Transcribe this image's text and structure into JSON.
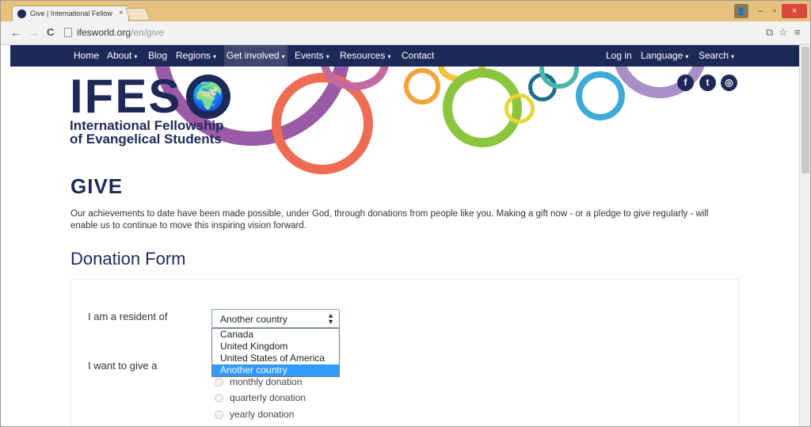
{
  "browser": {
    "tab_title": "Give | International Fellow",
    "tab_close": "×",
    "url_host": "ifesworld.org",
    "url_path": "/en/give",
    "back_icon": "←",
    "forward_icon": "→",
    "reload_icon": "C",
    "window_min": "–",
    "window_max": "▫",
    "window_close": "×"
  },
  "site_nav": {
    "left": [
      {
        "label": "Home",
        "caret": ""
      },
      {
        "label": "About",
        "caret": "▾"
      },
      {
        "label": "Blog",
        "caret": ""
      },
      {
        "label": "Regions",
        "caret": "▾"
      },
      {
        "label": "Get involved",
        "caret": "▾"
      },
      {
        "label": "Events",
        "caret": "▾"
      },
      {
        "label": "Resources",
        "caret": "▾"
      },
      {
        "label": "Contact",
        "caret": ""
      }
    ],
    "right": [
      {
        "label": "Log in",
        "caret": ""
      },
      {
        "label": "Language",
        "caret": "▾"
      },
      {
        "label": "Search",
        "caret": "▾"
      }
    ]
  },
  "header": {
    "logo_text": "IFES",
    "logo_line1": "International Fellowship",
    "logo_line2": "of Evangelical Students",
    "social": [
      "f",
      "t",
      "◎"
    ]
  },
  "main": {
    "title": "GIVE",
    "intro": "Our achievements to date have been made possible, under God, through donations from people like you. Making a gift now - or a pledge to give regularly - will enable us to continue to move this inspiring vision forward.",
    "form_title": "Donation Form",
    "resident_label": "I am a resident of",
    "resident_selected": "Another country",
    "resident_options": [
      "Canada",
      "United Kingdom",
      "United States of America",
      "Another country"
    ],
    "give_label": "I want to give a",
    "frequency_options": [
      "monthly donation",
      "quarterly donation",
      "yearly donation"
    ]
  },
  "colors": {
    "brand_navy": "#1d2a57",
    "tab_bar": "#e6c27e",
    "selection_blue": "#3399ff"
  }
}
